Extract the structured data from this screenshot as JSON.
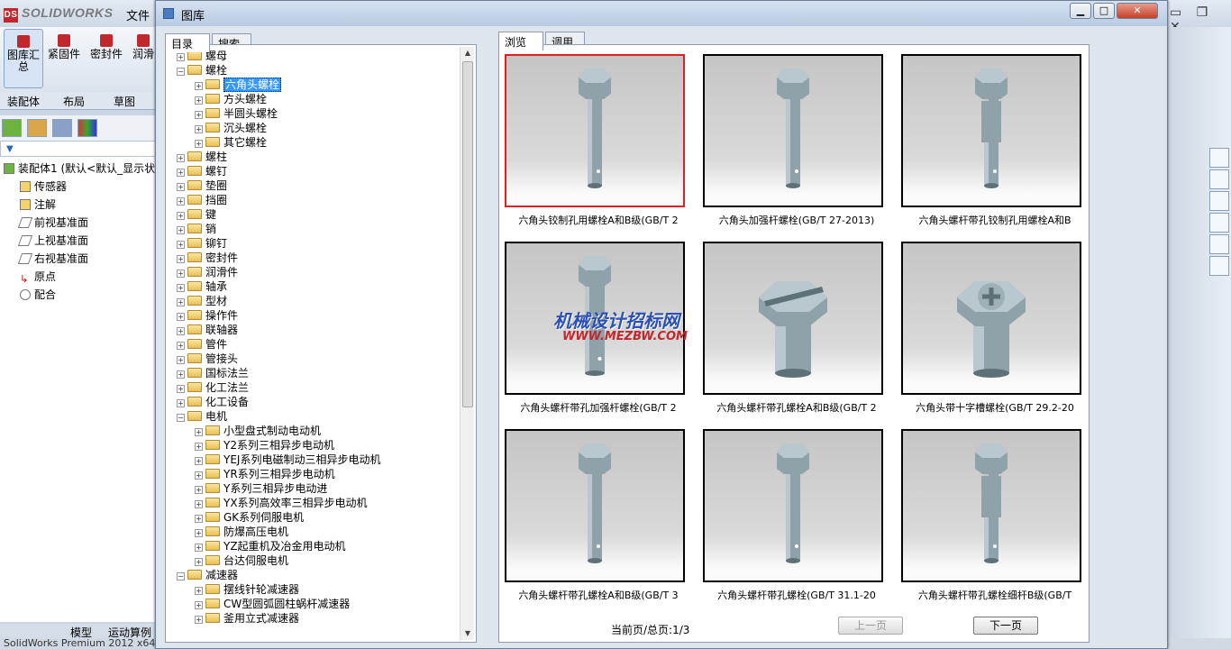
{
  "app": {
    "logo": "SOLIDWORKS",
    "file_menu": "文件"
  },
  "ribbon": {
    "buttons": [
      {
        "label": "图库汇总"
      },
      {
        "label": "紧固件"
      },
      {
        "label": "密封件"
      },
      {
        "label": "润滑"
      }
    ]
  },
  "cmd_tabs": [
    "装配体",
    "布局",
    "草图"
  ],
  "feature_tree": {
    "root": "装配体1 (默认<默认_显示状",
    "items": [
      "传感器",
      "注解",
      "前视基准面",
      "上视基准面",
      "右视基准面",
      "原点",
      "配合"
    ]
  },
  "bottom_tabs": [
    "模型",
    "运动算例"
  ],
  "status": "SolidWorks Premium 2012 x64",
  "dialog": {
    "title": "图库",
    "left_tabs": [
      "目录",
      "搜索"
    ],
    "right_tabs": [
      "浏览",
      "调用"
    ],
    "tree": [
      {
        "label": "螺母",
        "level": 0
      },
      {
        "label": "螺栓",
        "level": 0,
        "open": true
      },
      {
        "label": "六角头螺栓",
        "level": 1,
        "selected": true
      },
      {
        "label": "方头螺栓",
        "level": 1
      },
      {
        "label": "半圆头螺栓",
        "level": 1
      },
      {
        "label": "沉头螺栓",
        "level": 1
      },
      {
        "label": "其它螺栓",
        "level": 1
      },
      {
        "label": "螺柱",
        "level": 0
      },
      {
        "label": "螺钉",
        "level": 0
      },
      {
        "label": "垫圈",
        "level": 0
      },
      {
        "label": "挡圈",
        "level": 0
      },
      {
        "label": "键",
        "level": 0
      },
      {
        "label": "销",
        "level": 0
      },
      {
        "label": "铆钉",
        "level": 0
      },
      {
        "label": "密封件",
        "level": 0
      },
      {
        "label": "润滑件",
        "level": 0
      },
      {
        "label": "轴承",
        "level": 0
      },
      {
        "label": "型材",
        "level": 0
      },
      {
        "label": "操作件",
        "level": 0
      },
      {
        "label": "联轴器",
        "level": 0
      },
      {
        "label": "管件",
        "level": 0
      },
      {
        "label": "管接头",
        "level": 0
      },
      {
        "label": "国标法兰",
        "level": 0
      },
      {
        "label": "化工法兰",
        "level": 0
      },
      {
        "label": "化工设备",
        "level": 0
      },
      {
        "label": "电机",
        "level": 0,
        "open": true
      },
      {
        "label": "小型盘式制动电动机",
        "level": 1
      },
      {
        "label": "Y2系列三相异步电动机",
        "level": 1
      },
      {
        "label": "YEJ系列电磁制动三相异步电动机",
        "level": 1
      },
      {
        "label": "YR系列三相异步电动机",
        "level": 1
      },
      {
        "label": "Y系列三相异步电动进",
        "level": 1
      },
      {
        "label": "YX系列高效率三相异步电动机",
        "level": 1
      },
      {
        "label": "GK系列伺服电机",
        "level": 1
      },
      {
        "label": "防爆高压电机",
        "level": 1
      },
      {
        "label": "YZ起重机及冶金用电动机",
        "level": 1
      },
      {
        "label": "台达伺服电机",
        "level": 1
      },
      {
        "label": "减速器",
        "level": 0,
        "open": true
      },
      {
        "label": "摆线针轮减速器",
        "level": 1
      },
      {
        "label": "CW型圆弧圆柱蜗杆减速器",
        "level": 1
      },
      {
        "label": "釜用立式减速器",
        "level": 1
      }
    ],
    "cards": [
      {
        "caption": "六角头铰制孔用螺栓A和B级(GB/T 2",
        "type": "plain",
        "selected": true
      },
      {
        "caption": "六角头加强杆螺栓(GB/T 27-2013)",
        "type": "plain"
      },
      {
        "caption": "六角头螺杆带孔铰制孔用螺栓A和B",
        "type": "reamed"
      },
      {
        "caption": "六角头螺杆带孔加强杆螺栓(GB/T 2",
        "type": "big"
      },
      {
        "caption": "六角头螺杆带孔螺栓A和B级(GB/T 2",
        "type": "slot"
      },
      {
        "caption": "六角头带十字槽螺栓(GB/T 29.2-20",
        "type": "cross"
      },
      {
        "caption": "六角头螺杆带孔螺栓A和B级(GB/T 3",
        "type": "plain"
      },
      {
        "caption": "六角头螺杆带孔螺栓(GB/T 31.1-20",
        "type": "plain"
      },
      {
        "caption": "六角头螺杆带孔螺栓细杆B级(GB/T",
        "type": "reamed"
      }
    ],
    "page_info": "当前页/总页:1/3",
    "prev_label": "上一页",
    "next_label": "下一页",
    "watermark_line1": "机械设计招标网",
    "watermark_line2": "WWW.MEZBW.COM"
  }
}
